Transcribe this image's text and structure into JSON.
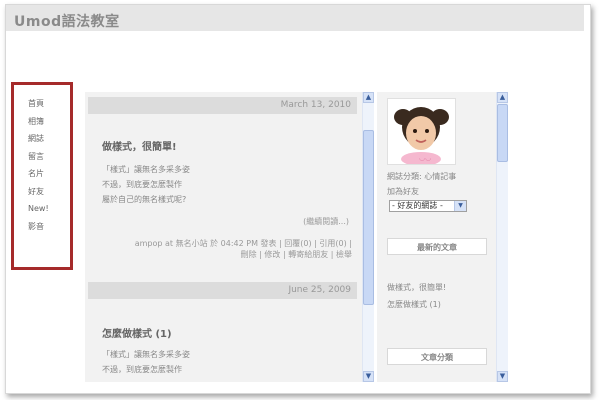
{
  "site": {
    "title": "Umod語法教室"
  },
  "nav": {
    "items": [
      {
        "label": "首頁"
      },
      {
        "label": "相簿"
      },
      {
        "label": "網誌"
      },
      {
        "label": "留言"
      },
      {
        "label": "名片"
      },
      {
        "label": "好友"
      },
      {
        "label": "New!"
      },
      {
        "label": "影音"
      }
    ]
  },
  "posts": [
    {
      "date": "March 13, 2010",
      "title": "做樣式，很簡單!",
      "lines": [
        "「樣式」讓無名多采多姿",
        "不過，到底要怎麼製作",
        "屬於自己的無名樣式呢?"
      ],
      "read_more": "(繼續閱讀...)",
      "meta_line1": "ampop at 無名小站 於 04:42 PM 發表 | 回覆(0) | 引用(0) |",
      "meta_line2": "刪除 | 修改 | 轉寄給朋友 | 檢舉"
    },
    {
      "date": "June 25, 2009",
      "title": "怎麼做樣式 (1)",
      "lines": [
        "「樣式」讓無名多采多姿",
        "不過，到底要怎麼製作"
      ]
    }
  ],
  "sidebar": {
    "category": "網誌分類: 心情記事",
    "add_friend": "加為好友",
    "friend_select": "- 好友的網誌 -",
    "latest_posts_title": "最新的文章",
    "latest_posts": [
      "做樣式，很簡單!",
      "怎麼做樣式 (1)"
    ],
    "categories_title": "文章分類"
  },
  "colors": {
    "highlight_border": "#a52a2a",
    "header_bg": "#e6e6e6",
    "scroll_accent": "#c8d8f5"
  }
}
